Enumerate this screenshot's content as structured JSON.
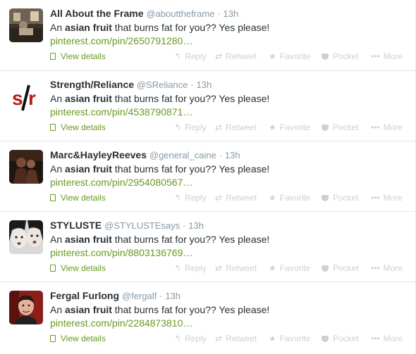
{
  "tweets": [
    {
      "fullname": "All About the Frame",
      "username": "@abouttheframe",
      "sep": "·",
      "time": "13h",
      "text_pre": "An ",
      "text_bold": "asian fruit",
      "text_post": " that burns fat for you?? Yes please!",
      "link": "pinterest.com/pin/2650791280…",
      "avatar": "frame-shop-icon"
    },
    {
      "fullname": "Strength/Reliance",
      "username": "@SReliance",
      "sep": "·",
      "time": "13h",
      "text_pre": "An ",
      "text_bold": "asian fruit",
      "text_post": " that burns fat for you?? Yes please!",
      "link": "pinterest.com/pin/4538790871…",
      "avatar": "sr-logo-icon"
    },
    {
      "fullname": "Marc&HayleyReeves",
      "username": "@general_caine",
      "sep": "·",
      "time": "13h",
      "text_pre": "An ",
      "text_bold": "asian fruit",
      "text_post": " that burns fat for you?? Yes please!",
      "link": "pinterest.com/pin/2954080567…",
      "avatar": "couple-photo-icon"
    },
    {
      "fullname": "STYLUSTE",
      "username": "@STYLUSTEsays",
      "sep": "·",
      "time": "13h",
      "text_pre": "An ",
      "text_bold": "asian fruit",
      "text_post": " that burns fat for you?? Yes please!",
      "link": "pinterest.com/pin/8803136769…",
      "avatar": "faces-photo-icon"
    },
    {
      "fullname": "Fergal Furlong",
      "username": "@fergalf",
      "sep": "·",
      "time": "13h",
      "text_pre": "An ",
      "text_bold": "asian fruit",
      "text_post": " that burns fat for you?? Yes please!",
      "link": "pinterest.com/pin/2284873810…",
      "avatar": "man-portrait-icon"
    }
  ],
  "actions": {
    "details": "View details",
    "reply": "Reply",
    "retweet": "Retweet",
    "favorite": "Favorite",
    "pocket": "Pocket",
    "more": "More"
  },
  "icons": {
    "details": "document-icon",
    "reply": "reply-arrow-icon",
    "retweet": "retweet-icon",
    "favorite": "star-icon",
    "pocket": "pocket-icon",
    "more": "ellipsis-icon"
  },
  "colors": {
    "link": "#689a20",
    "muted": "#8899a6",
    "action": "#c9d2d9",
    "divider": "#e1e8ed"
  }
}
